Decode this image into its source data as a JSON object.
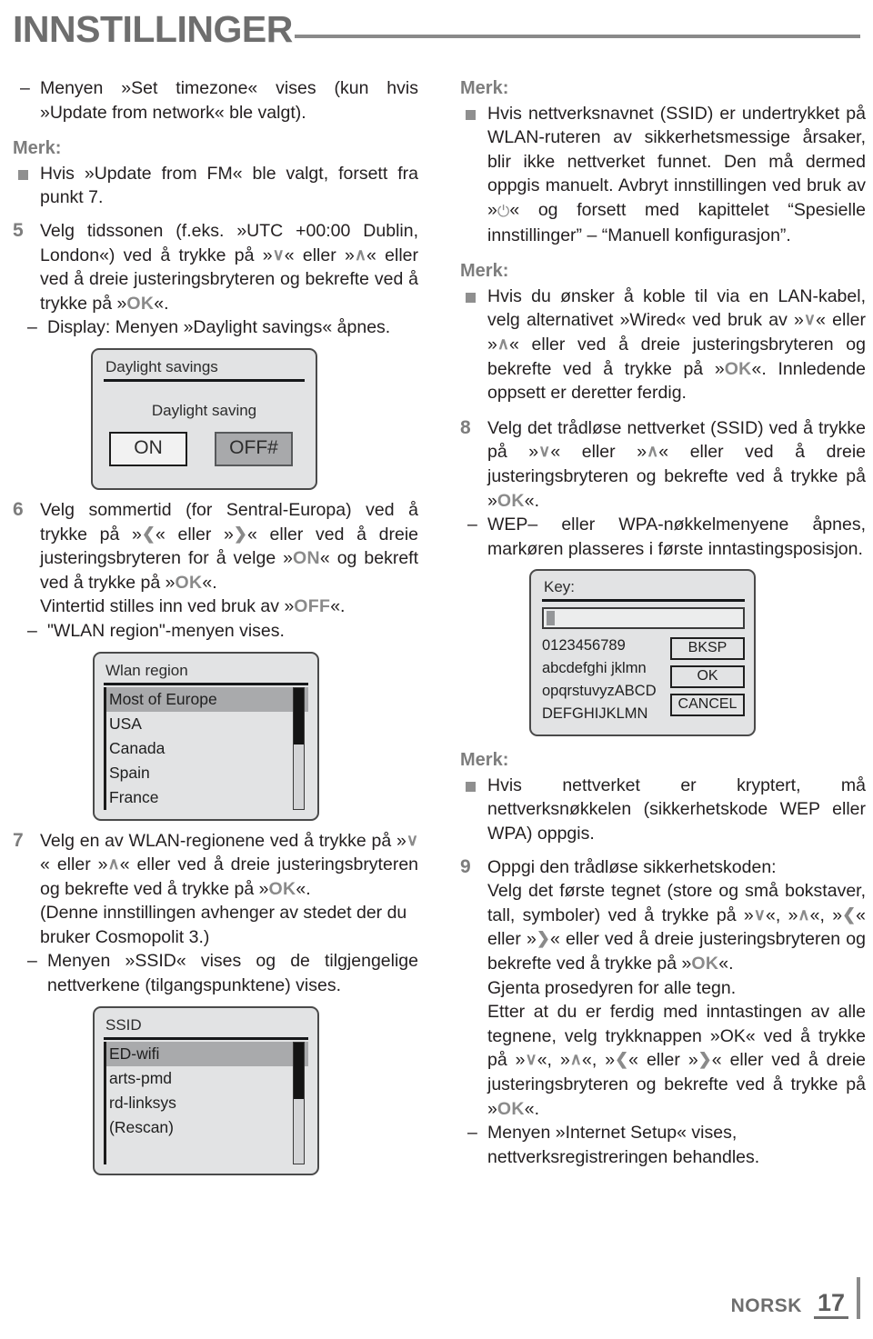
{
  "header": {
    "title": "INNSTILLINGER"
  },
  "footer": {
    "language": "NORSK",
    "page_number": "17"
  },
  "left_column": {
    "intro_dash": {
      "dash": "–",
      "text": "Menyen »Set timezone« vises (kun hvis »Update from network« ble valgt)."
    },
    "note1": {
      "heading": "Merk:",
      "bullet_text_a": "Hvis »Update from FM« ble valgt, forsett fra punkt 7."
    },
    "step5": {
      "number": "5",
      "part_a": "Velg tidssonen (f.eks. »UTC +00:00 Dublin, London«) ved å trykke på »",
      "key_down": "∨",
      "part_b": "« eller »",
      "key_up": "∧",
      "part_c": "« eller ved å dreie justeringsbryteren og bekrefte ved å trykke på »",
      "key_ok": "OK",
      "part_d": "«.",
      "dash_line": "Display: Menyen »Daylight savings« åpnes.",
      "dash": "–"
    },
    "daylight_screen": {
      "title": "Daylight savings",
      "subtitle": "Daylight saving",
      "button_on": "ON",
      "button_off": "OFF#"
    },
    "step6": {
      "number": "6",
      "part_a": "Velg sommertid (for Sentral-Europa) ved å trykke på »",
      "key_left": "❮",
      "part_b": "« eller »",
      "key_right": "❯",
      "part_c": "« eller ved å dreie justeringsbryteren for å velge »",
      "key_on": "ON",
      "part_d": "« og bekreft ved å trykke på »",
      "key_ok": "OK",
      "part_e": "«.",
      "line2_a": "Vintertid stilles inn ved bruk av »",
      "key_off": "OFF",
      "line2_b": "«.",
      "dash": "–",
      "dash_line": "\"WLAN region\"-menyen vises."
    },
    "wlan_region_screen": {
      "title": "Wlan region",
      "items": [
        {
          "label": "Most of Europe",
          "selected": true
        },
        {
          "label": "USA",
          "selected": false
        },
        {
          "label": "Canada",
          "selected": false
        },
        {
          "label": "Spain",
          "selected": false
        },
        {
          "label": "France",
          "selected": false
        }
      ]
    },
    "step7": {
      "number": "7",
      "part_a": "Velg en av WLAN-regionene ved å trykke på »",
      "key_down": "∨",
      "part_b": "« eller »",
      "key_up": "∧",
      "part_c": "« eller ved å dreie justeringsbryteren og bekrefte ved å trykke på »",
      "key_ok": "OK",
      "part_d": "«.",
      "line2": "(Denne innstillingen avhenger av stedet der du bruker Cosmopolit 3.)",
      "dash": "–",
      "dash_line": "Menyen »SSID« vises og de tilgjengelige nettverkene (tilgangspunktene) vises."
    },
    "ssid_screen": {
      "title": "SSID",
      "items": [
        {
          "label": "ED-wifi",
          "selected": true
        },
        {
          "label": "arts-pmd",
          "selected": false
        },
        {
          "label": "rd-linksys",
          "selected": false
        },
        {
          "label": "(Rescan)",
          "selected": false
        }
      ]
    }
  },
  "right_column": {
    "note1": {
      "heading": "Merk:",
      "part_a": "Hvis nettverksnavnet (SSID) er undertrykket på WLAN-ruteren av sikkerhetsmessige årsaker, blir ikke nettverket funnet. Den må dermed oppgis manuelt. Avbryt innstillingen ved bruk av »",
      "key_power": "⏻",
      "part_b": "« og forsett med kapittelet “Spesielle innstillinger” – “Manuell konfigurasjon”."
    },
    "note2": {
      "heading": "Merk:",
      "part_a": "Hvis du ønsker å koble til via en LAN-kabel, velg alternativet »Wired« ved bruk av »",
      "key_down": "∨",
      "part_b": "« eller »",
      "key_up": "∧",
      "part_c": "« eller ved å dreie justeringsbryteren og bekrefte ved å trykke på »",
      "key_ok": "OK",
      "part_d": "«. Innledende oppsett er deretter ferdig."
    },
    "step8": {
      "number": "8",
      "part_a": "Velg det trådløse nettverket (SSID) ved å trykke på »",
      "key_down": "∨",
      "part_b": "« eller »",
      "key_up": "∧",
      "part_c": "« eller ved å dreie justeringsbryteren og bekrefte ved å trykke på »",
      "key_ok": "OK",
      "part_d": "«.",
      "dash": "–",
      "dash_line": "WEP– eller WPA-nøkkelmenyene åpnes, markøren plasseres i første inntastingsposisjon."
    },
    "key_screen": {
      "title": "Key:",
      "input_value": "",
      "char_rows": [
        "0123456789",
        "abcdefghi jklmn",
        "opqrstuvyzABCD",
        "DEFGHIJKLMN"
      ],
      "buttons": [
        "BKSP",
        "OK",
        "CANCEL"
      ]
    },
    "note3": {
      "heading": "Merk:",
      "text": "Hvis nettverket er kryptert, må nettverksnøkkelen (sikkerhetskode WEP eller WPA) oppgis."
    },
    "step9": {
      "number": "9",
      "line1": "Oppgi den trådløse sikkerhetskoden:",
      "part_a": "Velg det første tegnet (store og små bokstaver, tall, symboler) ved å trykke på »",
      "key_down": "∨",
      "part_b": "«, »",
      "key_up": "∧",
      "part_c": "«, »",
      "key_left": "❮",
      "part_d": "« eller »",
      "key_right": "❯",
      "part_e": "« eller ved å dreie justeringsbryteren og bekrefte ved å trykke på »",
      "key_ok": "OK",
      "part_f": "«.",
      "line3": "Gjenta prosedyren for alle tegn.",
      "line4_a": "Etter at du er ferdig med inntastingen av alle tegnene, velg trykknappen »OK« ved å trykke på »",
      "l4_down": "∨",
      "line4_b": "«, »",
      "l4_up": "∧",
      "line4_c": "«, »",
      "l4_left": "❮",
      "line4_d": "« eller »",
      "l4_right": "❯",
      "line4_e": "« eller ved å dreie justeringsbryteren og bekrefte ved å trykke på »",
      "l4_ok": "OK",
      "line4_f": "«.",
      "dash": "–",
      "dash_line": "Menyen »Internet Setup« vises, nettverksregistreringen behandles."
    }
  }
}
